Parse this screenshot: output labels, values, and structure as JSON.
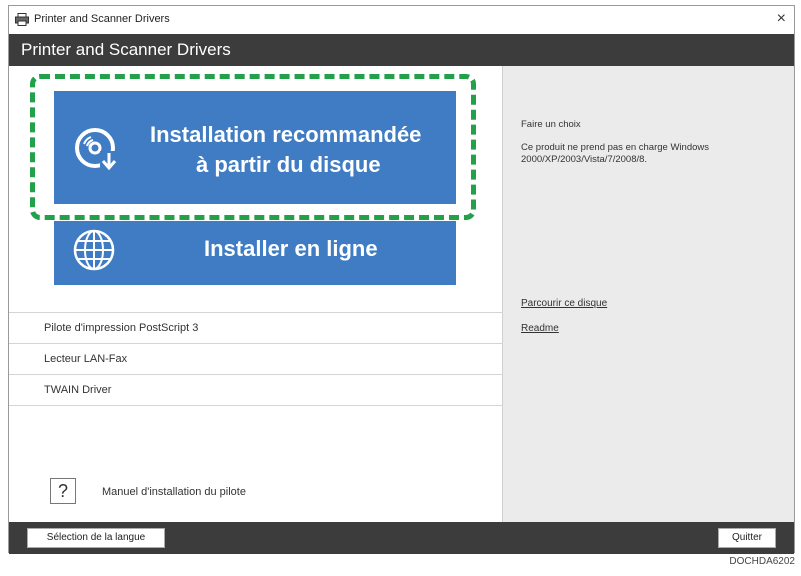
{
  "window": {
    "title": "Printer and Scanner Drivers",
    "close_glyph": "×"
  },
  "header": {
    "title": "Printer and Scanner Drivers"
  },
  "main": {
    "recommended_button": {
      "line1": "Installation recommandée",
      "line2": "à partir du disque",
      "icon": "disc-download-icon"
    },
    "online_button": {
      "label": "Installer en ligne",
      "icon": "globe-icon"
    },
    "driver_list": [
      "Pilote d'impression PostScript 3",
      "Lecteur LAN-Fax",
      "TWAIN Driver"
    ],
    "help_glyph": "?",
    "help_label": "Manuel d'installation du pilote"
  },
  "info_panel": {
    "prompt": "Faire un choix",
    "notice": "Ce produit ne prend pas en charge Windows 2000/XP/2003/Vista/7/2008/8.",
    "browse_link": "Parcourir ce disque",
    "readme_link": "Readme"
  },
  "footer": {
    "language_button": "Sélection de la langue",
    "quit_button": "Quitter"
  },
  "figure_code": "DOCHDA6202",
  "colors": {
    "accent_blue": "#3f7cc4",
    "highlight_green": "#22a04a",
    "bar_dark": "#3c3c3c"
  }
}
